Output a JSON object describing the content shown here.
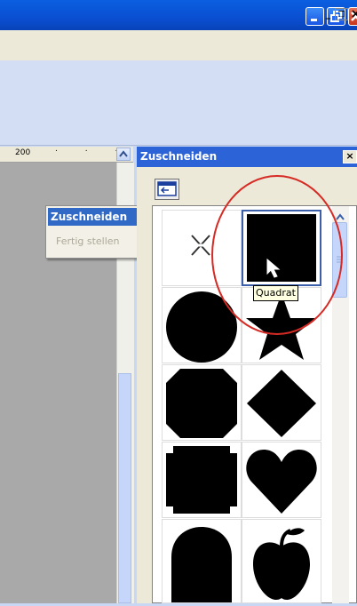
{
  "window": {
    "min_icon": "minimize-icon",
    "max_icon": "restore-icon",
    "close_icon": "close-icon",
    "mdi_min": "_",
    "mdi_restore": "❐",
    "mdi_close": "×"
  },
  "ruler": {
    "label": "200",
    "dots": ". . ."
  },
  "popup": {
    "items": [
      {
        "label": "Zuschneiden",
        "enabled": true
      },
      {
        "label": "Fertig stellen",
        "enabled": false
      }
    ]
  },
  "panel": {
    "title": "Zuschneiden",
    "close_label": "×",
    "scroll_up_label": "˄",
    "tooltip": "Quadrat",
    "shapes": [
      "none-icon",
      "square-icon",
      "circle-icon",
      "star-icon",
      "octagon-icon",
      "diamond-icon",
      "notched-square-icon",
      "heart-icon",
      "arch-icon",
      "apple-icon"
    ]
  },
  "colors": {
    "accent": "#2c63d6",
    "highlight_circle": "#d62a24"
  }
}
